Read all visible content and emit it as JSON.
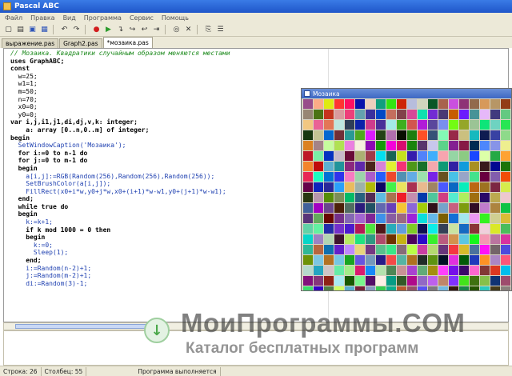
{
  "window": {
    "title": "Pascal ABC"
  },
  "menu": [
    "Файл",
    "Правка",
    "Вид",
    "Программа",
    "Сервис",
    "Помощь"
  ],
  "toolbar": [
    {
      "name": "new-icon",
      "glyph": "▢"
    },
    {
      "name": "open-icon",
      "glyph": "▤"
    },
    {
      "name": "save-icon",
      "glyph": "▣"
    },
    {
      "name": "save-all-icon",
      "glyph": "▦"
    },
    {
      "name": "undo-icon",
      "glyph": "↶"
    },
    {
      "name": "redo-icon",
      "glyph": "↷"
    },
    {
      "name": "stop-icon",
      "glyph": "●"
    },
    {
      "name": "run-icon",
      "glyph": "▶"
    },
    {
      "name": "step-into-icon",
      "glyph": "↴"
    },
    {
      "name": "step-over-icon",
      "glyph": "↪"
    },
    {
      "name": "step-out-icon",
      "glyph": "↩"
    },
    {
      "name": "run-to-cursor-icon",
      "glyph": "⇥"
    },
    {
      "name": "watch-icon",
      "glyph": "◎"
    },
    {
      "name": "breakpoint-icon",
      "glyph": "✕"
    },
    {
      "name": "copy-icon",
      "glyph": "⎘"
    },
    {
      "name": "format-icon",
      "glyph": "☰"
    }
  ],
  "tabs": [
    {
      "label": "выражение.pas",
      "active": false
    },
    {
      "label": "Graph2.pas",
      "active": false
    },
    {
      "label": "*мозаика.pas",
      "active": true
    }
  ],
  "code": {
    "l1": "// Мозаика. Квадратики случайным образом меняются местами",
    "l2": "uses GraphABC;",
    "l3": "",
    "l4": "const",
    "l5": "  w=25;",
    "l6": "  w1=1;",
    "l7": "  m=50;",
    "l8": "  n=70;",
    "l9": "  x0=0;",
    "l10": "  y0=0;",
    "l11": "",
    "l12": "var i,j,i1,j1,di,dj,v,k: integer;",
    "l13": "    a: array [0..n,0..m] of integer;",
    "l14": "",
    "l15": "begin",
    "l16": "  SetWindowCaption('Мозаика');",
    "l17": "  for i:=0 to n-1 do",
    "l18": "  for j:=0 to m-1 do",
    "l19": "  begin",
    "l20": "    a[i,j]:=RGB(Random(256),Random(256),Random(256));",
    "l21": "    SetBrushColor(a[i,j]);",
    "l22": "    FillRect(x0+i*w,y0+j*w,x0+(i+1)*w-w1,y0+(j+1)*w-w1);",
    "l23": "  end;",
    "l24": "  while true do",
    "l25": "  begin",
    "l26": "    k:=k+1;",
    "l27": "    if k mod 1000 = 0 then",
    "l28": "    begin",
    "l29": "      k:=0;",
    "l30": "      Sleep(1);",
    "l31": "    end;",
    "l32": "    i:=Random(n-2)+1;",
    "l33": "    j:=Random(m-2)+1;",
    "l34": "    di:=Random(3)-1;"
  },
  "mosaic_window": {
    "title": "Мозаика"
  },
  "status": {
    "line": "Строка: 26",
    "col": "Столбец: 55",
    "message": "Программа выполняется"
  },
  "watermark": {
    "title": "МоиПрограммы.COM",
    "subtitle": "Каталог бесплатных программ"
  },
  "colors": {
    "keyword": "#000000",
    "comment": "#1d8a1d",
    "string": "#1d3fb0"
  }
}
